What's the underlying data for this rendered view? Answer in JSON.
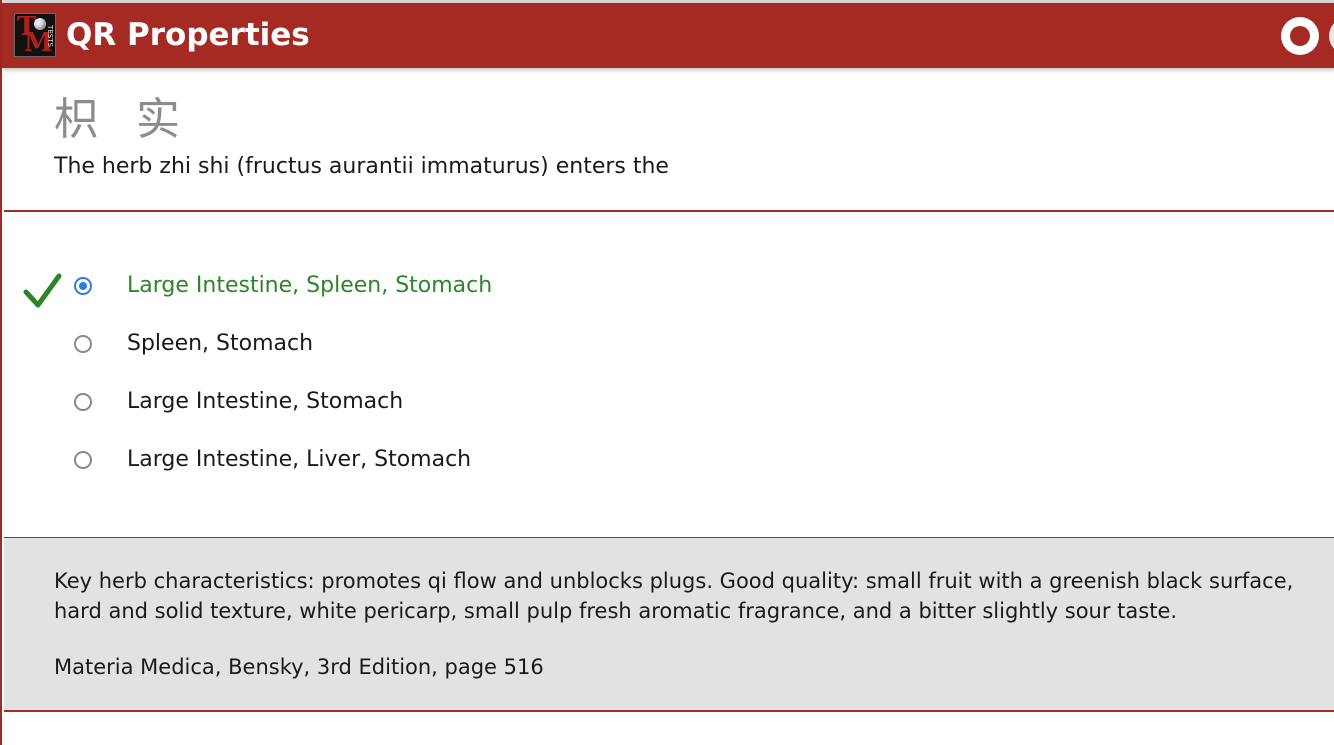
{
  "window": {
    "title": "QR Properties"
  },
  "colors": {
    "header": "#a52a24",
    "correct": "#2e8528",
    "radio_selected": "#2f7be6",
    "explanation_bg": "#e2e2e2"
  },
  "question": {
    "chinese_name": "枳 实",
    "text": "The herb zhi shi (fructus aurantii immaturus) enters the"
  },
  "options": [
    {
      "label": "Large Intestine, Spleen, Stomach",
      "selected": true,
      "correct": true
    },
    {
      "label": "Spleen, Stomach",
      "selected": false,
      "correct": false
    },
    {
      "label": "Large Intestine, Stomach",
      "selected": false,
      "correct": false
    },
    {
      "label": "Large Intestine, Liver, Stomach",
      "selected": false,
      "correct": false
    }
  ],
  "explanation": {
    "text": "Key herb characteristics: promotes qi flow and unblocks plugs. Good quality: small fruit with a greenish black surface, hard and solid texture, white pericarp, small pulp fresh aromatic fragrance, and a bitter slightly sour taste.",
    "reference": "Materia Medica, Bensky, 3rd Edition, page 516"
  },
  "icons": {
    "logo": "tcm-tests-logo",
    "record": "record-icon",
    "check": "checkmark-icon"
  }
}
